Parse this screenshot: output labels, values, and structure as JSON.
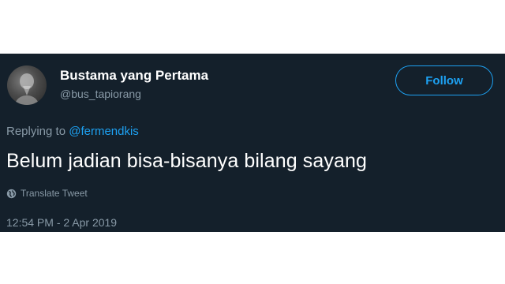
{
  "tweet": {
    "author": {
      "display_name": "Bustama yang Pertama",
      "handle": "@bus_tapiorang"
    },
    "follow_label": "Follow",
    "replying_prefix": "Replying to",
    "replying_to": "@fermendkis",
    "text": "Belum jadian bisa-bisanya bilang sayang",
    "translate_label": "Translate Tweet",
    "timestamp": "12:54 PM - 2 Apr 2019"
  },
  "colors": {
    "card_background": "#14202b",
    "accent": "#1da1f2",
    "secondary_text": "#8899a6",
    "primary_text": "#ffffff"
  },
  "icons": {
    "translate": "globe-icon"
  }
}
